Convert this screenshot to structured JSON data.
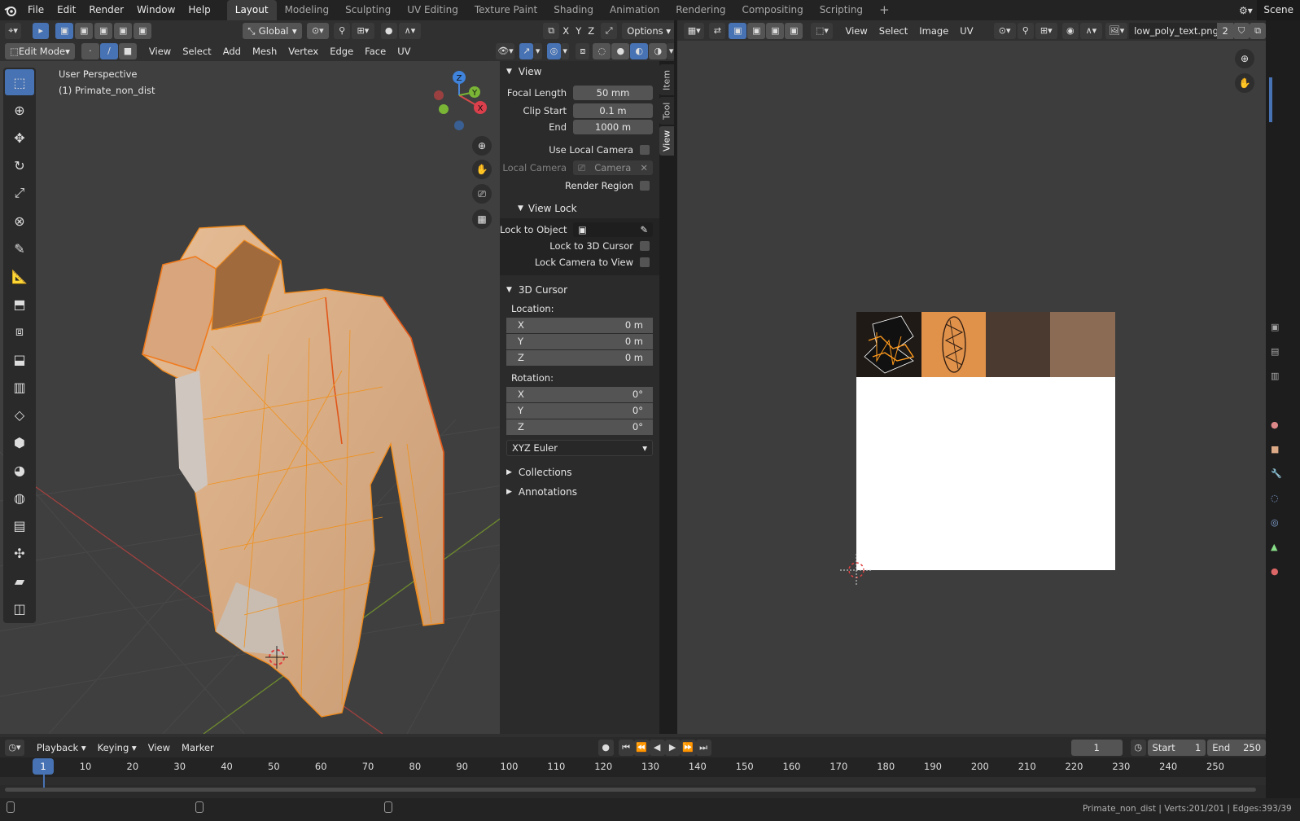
{
  "topbar": {
    "menus": [
      "File",
      "Edit",
      "Render",
      "Window",
      "Help"
    ],
    "workspaces": [
      "Layout",
      "Modeling",
      "Sculpting",
      "UV Editing",
      "Texture Paint",
      "Shading",
      "Animation",
      "Rendering",
      "Compositing",
      "Scripting"
    ],
    "active_workspace": "Layout",
    "add_tab": "+",
    "scene_label": "Scene"
  },
  "viewport_header": {
    "transform_orientation": "Global",
    "axes": [
      "X",
      "Y",
      "Z"
    ],
    "options_label": "Options",
    "mode": "Edit Mode",
    "menus": [
      "View",
      "Select",
      "Add",
      "Mesh",
      "Vertex",
      "Edge",
      "Face",
      "UV"
    ]
  },
  "viewport": {
    "perspective_label": "User Perspective",
    "object_label": "(1) Primate_non_dist",
    "gizmo": {
      "x": "X",
      "y": "Y",
      "z": "Z"
    }
  },
  "npanel": {
    "tabs": [
      "Item",
      "Tool",
      "View"
    ],
    "view_section": "View",
    "focal_length_label": "Focal Length",
    "focal_length_value": "50 mm",
    "clip_start_label": "Clip Start",
    "clip_start_value": "0.1 m",
    "clip_end_label": "End",
    "clip_end_value": "1000 m",
    "use_local_camera_label": "Use Local Camera",
    "local_camera_label": "Local Camera",
    "local_camera_value": "Camera",
    "render_region_label": "Render Region",
    "view_lock_section": "View Lock",
    "lock_to_object_label": "Lock to Object",
    "lock_to_3d_cursor_label": "Lock to 3D Cursor",
    "lock_camera_to_view_label": "Lock Camera to View",
    "cursor_section": "3D Cursor",
    "location_label": "Location:",
    "location": [
      {
        "axis": "X",
        "value": "0 m"
      },
      {
        "axis": "Y",
        "value": "0 m"
      },
      {
        "axis": "Z",
        "value": "0 m"
      }
    ],
    "rotation_label": "Rotation:",
    "rotation": [
      {
        "axis": "X",
        "value": "0°"
      },
      {
        "axis": "Y",
        "value": "0°"
      },
      {
        "axis": "Z",
        "value": "0°"
      }
    ],
    "rotation_mode": "XYZ Euler",
    "collections_section": "Collections",
    "annotations_section": "Annotations"
  },
  "image_editor_header": {
    "menus": [
      "View",
      "Select",
      "Image",
      "UV"
    ],
    "image_name": "low_poly_text.png",
    "users": "2"
  },
  "texture_colors": [
    "#1f1a16",
    "#e0914a",
    "#4a3a30",
    "#8c6b55"
  ],
  "timeline": {
    "menus": [
      "Playback",
      "Keying",
      "View",
      "Marker"
    ],
    "current_frame": "1",
    "start_label": "Start",
    "start_value": "1",
    "end_label": "End",
    "end_value": "250",
    "frame_ticks": [
      "1",
      "10",
      "20",
      "30",
      "40",
      "50",
      "60",
      "70",
      "80",
      "90",
      "100",
      "110",
      "120",
      "130",
      "140",
      "150",
      "160",
      "170",
      "180",
      "190",
      "200",
      "210",
      "220",
      "230",
      "240",
      "250"
    ]
  },
  "statusbar": {
    "text": "Primate_non_dist | Verts:201/201 | Edges:393/39"
  }
}
